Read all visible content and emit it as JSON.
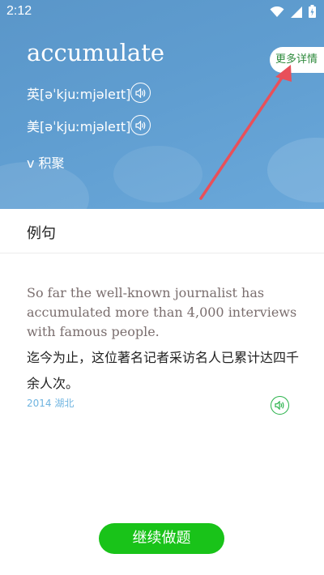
{
  "status_bar": {
    "time": "2:12",
    "icons": [
      "wifi-icon",
      "signal-icon",
      "battery-icon"
    ]
  },
  "word_card": {
    "word": "accumulate",
    "pronunciations": [
      {
        "label": "英[əˈkjuːmjəleɪt]"
      },
      {
        "label": "美[əˈkjuːmjəleɪt]"
      }
    ],
    "part_of_speech": "v 积聚",
    "more_details_label": "更多详情"
  },
  "examples_section": {
    "title": "例句",
    "example": {
      "english": "So far the well-known journalist has accumulated more than 4,000 interviews with famous people.",
      "chinese": "迄今为止，这位著名记者采访名人已累计达四千余人次。",
      "source": "2014 湖北"
    }
  },
  "actions": {
    "continue_label": "继续做题"
  },
  "colors": {
    "header_blue": "#5f9dd0",
    "accent_green": "#19c319",
    "speaker_green": "#29b24a",
    "arrow_red": "#e8505a",
    "source_blue": "#6fb4e0"
  }
}
